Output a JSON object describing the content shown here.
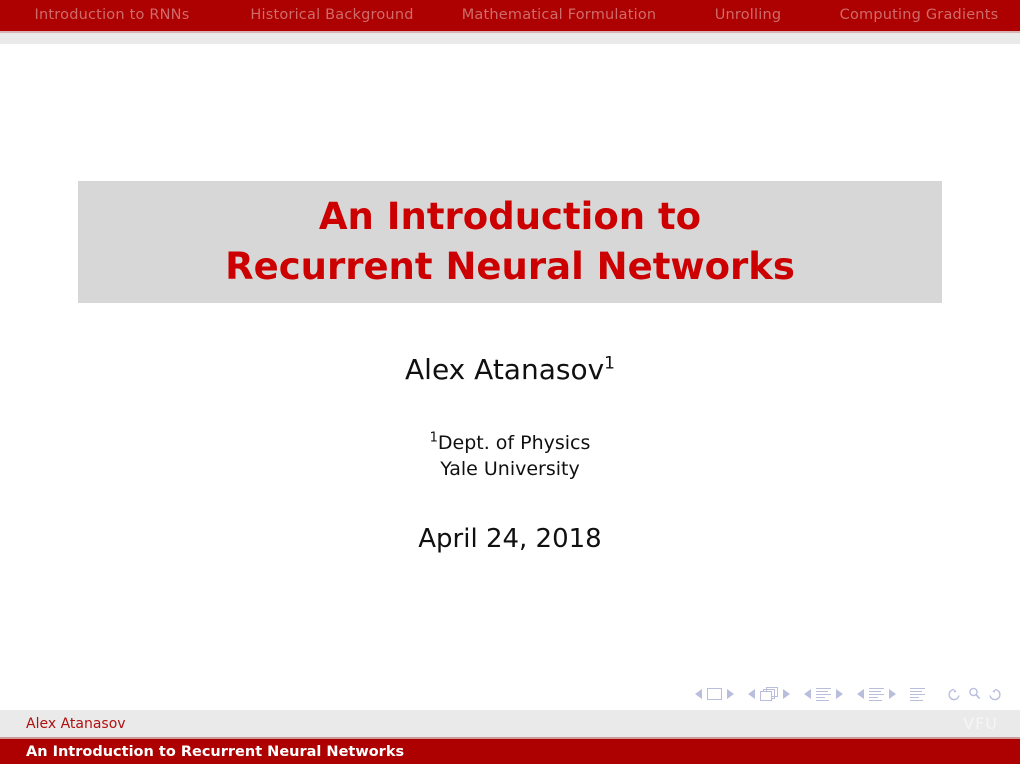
{
  "navbar": {
    "sections": [
      {
        "label": "Introduction to RNNs"
      },
      {
        "label": "Historical Background"
      },
      {
        "label": "Mathematical Formulation"
      },
      {
        "label": "Unrolling"
      },
      {
        "label": "Computing Gradients"
      }
    ]
  },
  "title": {
    "line1": "An Introduction to",
    "line2": "Recurrent Neural Networks"
  },
  "author": {
    "name": "Alex Atanasov",
    "footnote_marker": "1"
  },
  "institute": {
    "footnote_marker": "1",
    "line1": "Dept. of Physics",
    "line2": "Yale University"
  },
  "date": {
    "text": "April 24, 2018"
  },
  "footer": {
    "author": "Alex Atanasov",
    "institute": "VFU",
    "title": "An Introduction to Recurrent Neural Networks"
  },
  "nav_symbols": {
    "slide_prev": "◀",
    "slide_next": "▶",
    "frame_prev": "◀",
    "frame_next": "▶",
    "subsection_prev": "◀",
    "subsection_next": "▶",
    "section_prev": "◀",
    "section_next": "▶",
    "back": "↺",
    "search": "⚲",
    "forward": "↻"
  },
  "colors": {
    "theme_red": "#ad0000",
    "title_red": "#cc0000",
    "title_block_bg": "#d7d7d7",
    "footer_bg": "#eaeaea",
    "nav_item_text": "#cf6b6b",
    "nav_symbol": "#b9bedd"
  }
}
